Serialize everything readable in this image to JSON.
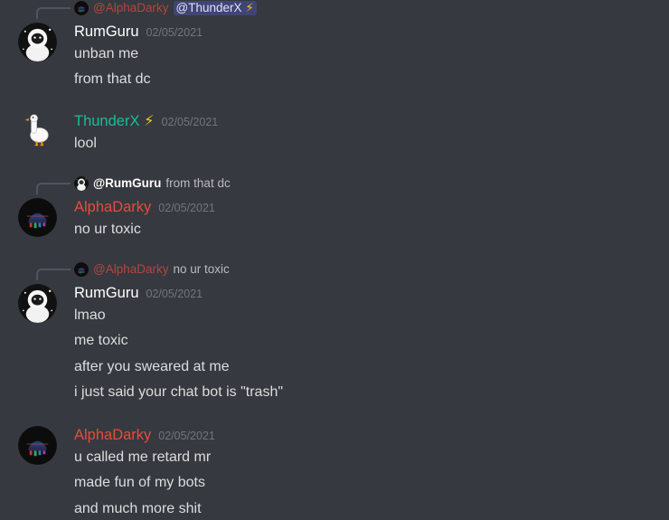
{
  "colors": {
    "background": "#36393f",
    "rumguru": "#ffffff",
    "thunderx": "#1abc9c",
    "alphadarky": "#e74c3c",
    "timestamp": "#72767d",
    "text": "#dcddde"
  },
  "top_reply": {
    "author": "@AlphaDarky",
    "mention": "@ThunderX",
    "bolt": "⚡"
  },
  "messages": [
    {
      "author": "RumGuru",
      "timestamp": "02/05/2021",
      "avatar_icon": "astronaut-avatar",
      "lines": [
        "unban me",
        "from that dc"
      ]
    },
    {
      "author": "ThunderX",
      "bolt": "⚡",
      "timestamp": "02/05/2021",
      "avatar_icon": "goose-avatar",
      "lines": [
        "lool"
      ]
    },
    {
      "reply": {
        "author": "@RumGuru",
        "text": "from that dc"
      },
      "author": "AlphaDarky",
      "timestamp": "02/05/2021",
      "avatar_icon": "glitch-avatar",
      "lines": [
        "no ur toxic"
      ]
    },
    {
      "reply": {
        "author": "@AlphaDarky",
        "text": "no ur toxic"
      },
      "author": "RumGuru",
      "timestamp": "02/05/2021",
      "avatar_icon": "astronaut-avatar",
      "lines": [
        "lmao",
        "me toxic",
        "after you sweared at me",
        "i just said your chat bot is \"trash\""
      ]
    },
    {
      "author": "AlphaDarky",
      "timestamp": "02/05/2021",
      "avatar_icon": "glitch-avatar",
      "lines": [
        "u called me retard mr",
        "made fun of my bots",
        "and much more shit"
      ]
    }
  ]
}
